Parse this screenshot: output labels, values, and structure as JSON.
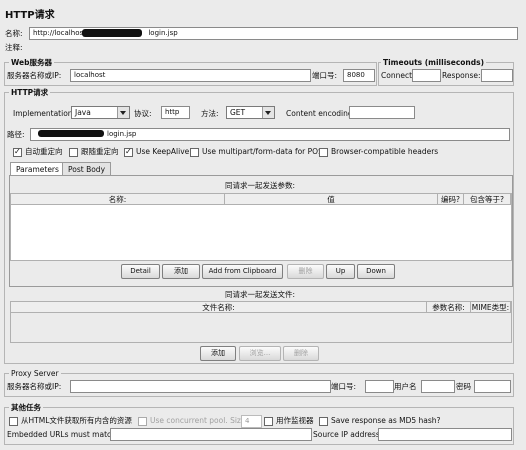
{
  "title": "HTTP请求",
  "name_label": "名称:",
  "name_value": "http://localhost",
  "name_value_tail": "login.jsp",
  "comment_label": "注释:",
  "web_server": {
    "legend": "Web服务器",
    "server_label": "服务器名称或IP:",
    "server_value": "localhost",
    "port_label": "端口号:",
    "port_value": "8080"
  },
  "timeouts": {
    "legend": "Timeouts (milliseconds)",
    "connect_label": "Connect:",
    "connect_value": "",
    "response_label": "Response:",
    "response_value": ""
  },
  "http_request": {
    "legend": "HTTP请求",
    "impl_label": "Implementation:",
    "impl_value": "Java",
    "protocol_label": "协议:",
    "protocol_value": "http",
    "method_label": "方法:",
    "method_value": "GET",
    "encoding_label": "Content encoding:",
    "encoding_value": "",
    "path_label": "路径:",
    "path_value": "login.jsp"
  },
  "options": {
    "auto_redirect": "自动重定向",
    "follow_redirect": "跟随重定向",
    "keepalive": "Use KeepAlive",
    "multipart": "Use multipart/form-data for POST",
    "browser_headers": "Browser-compatible headers"
  },
  "tabs": {
    "parameters": "Parameters",
    "post_body": "Post Body"
  },
  "params_table": {
    "caption": "同请求一起发送参数:",
    "columns": [
      "名称:",
      "值",
      "编码?",
      "包含等于?"
    ]
  },
  "params_buttons": {
    "detail": "Detail",
    "add": "添加",
    "add_clipboard": "Add from Clipboard",
    "delete": "删除",
    "up": "Up",
    "down": "Down"
  },
  "files_table": {
    "caption": "同请求一起发送文件:",
    "columns": [
      "文件名称:",
      "参数名称:",
      "MIME类型:"
    ]
  },
  "files_buttons": {
    "add": "添加",
    "browse": "浏览...",
    "delete": "删除"
  },
  "proxy": {
    "legend": "Proxy Server",
    "server_label": "服务器名称或IP:",
    "port_label": "端口号:",
    "user_label": "用户名",
    "password_label": "密码"
  },
  "other": {
    "legend": "其他任务",
    "retrieve_resources": "从HTML文件获取所有内含的资源",
    "concurrent_pool": "Use concurrent pool. Size:",
    "pool_size": "4",
    "monitor": "用作监视器",
    "md5": "Save response as MD5 hash?",
    "embedded_label": "Embedded URLs must match:",
    "source_ip_label": "Source IP address:"
  }
}
